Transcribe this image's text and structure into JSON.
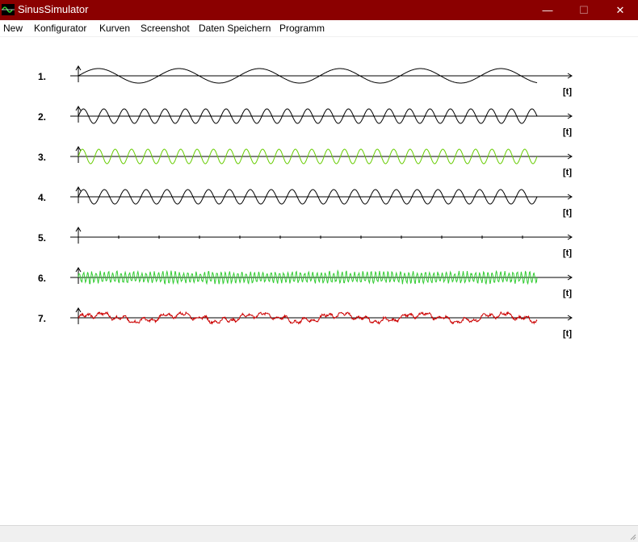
{
  "window": {
    "title": "SinusSimulator",
    "icon": "sine-wave-app-icon",
    "controls": {
      "minimize": "—",
      "maximize": "☐",
      "close": "✕"
    }
  },
  "menu": [
    {
      "label": "New"
    },
    {
      "label": "Konfigurator"
    },
    {
      "label": "Kurven"
    },
    {
      "label": "Screenshot"
    },
    {
      "label": "Daten Speichern"
    },
    {
      "label": "Programm"
    }
  ],
  "colors": {
    "titlebar": "#8b0000",
    "axis": "#000000",
    "black_curve": "#000000",
    "green_curve": "#66cc00",
    "light_green_curve": "#33cc33",
    "red_curve": "#cc0000"
  },
  "chart_data": {
    "type": "line",
    "x_axis_label": "[t]",
    "curves": [
      {
        "label": "1.",
        "color": "black",
        "kind": "sine",
        "cycles": 5.7,
        "amplitude": 0.9
      },
      {
        "label": "2.",
        "color": "black",
        "kind": "sine",
        "cycles": 22.5,
        "amplitude": 0.9
      },
      {
        "label": "3.",
        "color": "green",
        "kind": "sine",
        "cycles": 28,
        "amplitude": 0.9
      },
      {
        "label": "4.",
        "color": "black",
        "kind": "sine",
        "cycles": 22,
        "amplitude": 0.9
      },
      {
        "label": "5.",
        "color": "black",
        "kind": "flat",
        "cycles": 0,
        "amplitude": 0
      },
      {
        "label": "6.",
        "color": "light_green",
        "kind": "noise",
        "cycles": 110,
        "amplitude": 0.85
      },
      {
        "label": "7.",
        "color": "red",
        "kind": "sum",
        "cycles": 5.7,
        "amplitude": 0.9
      }
    ]
  }
}
